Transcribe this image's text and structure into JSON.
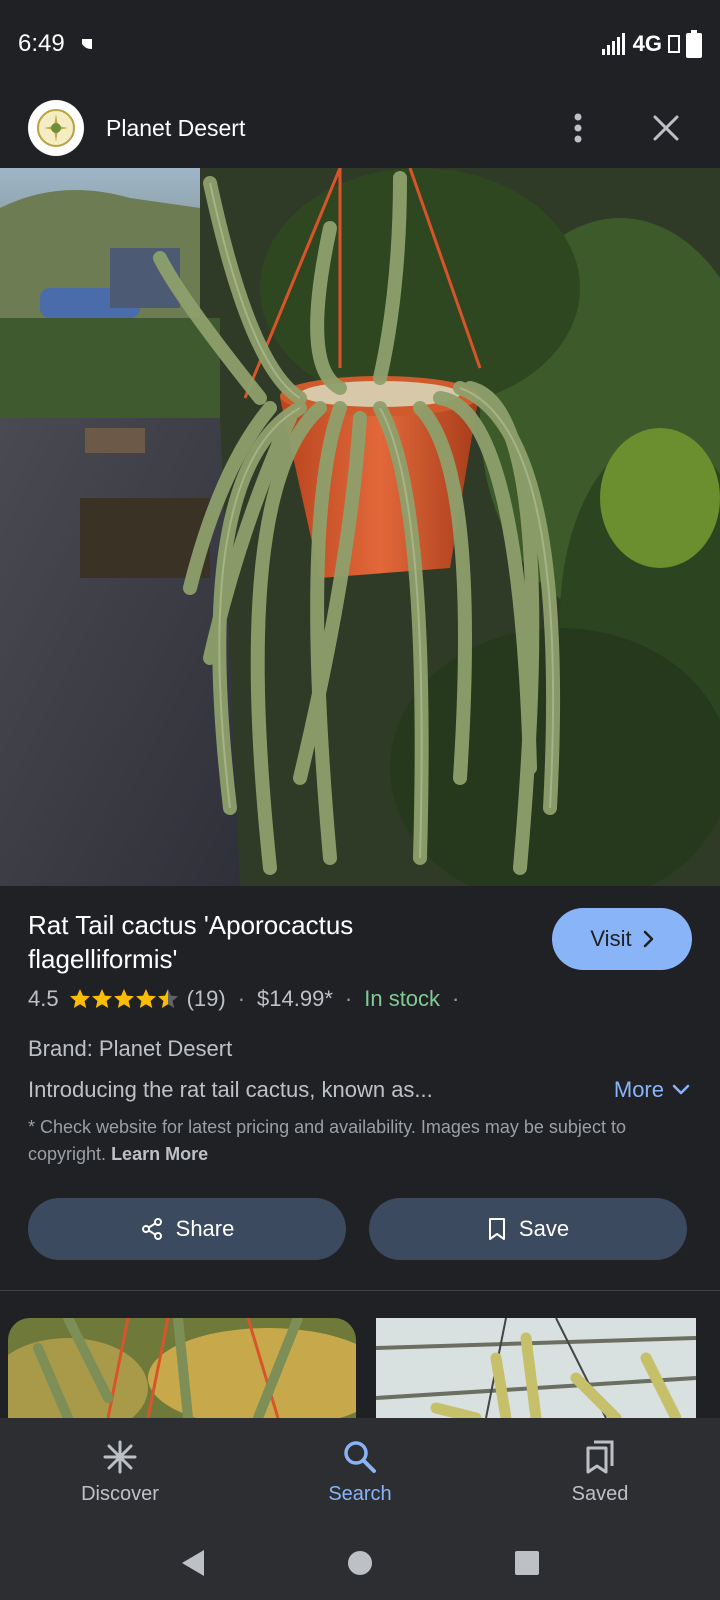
{
  "status_bar": {
    "time": "6:49",
    "network": "4G"
  },
  "header": {
    "site_name": "Planet Desert"
  },
  "product": {
    "title": "Rat Tail cactus 'Aporocactus flagelliformis'",
    "visit_label": "Visit",
    "rating": "4.5",
    "rating_stars": 4.5,
    "review_count": "(19)",
    "price": "$14.99*",
    "stock": "In stock",
    "brand": "Brand: Planet Desert",
    "description": "Introducing the rat tail cactus, known as...",
    "more_label": "More",
    "disclaimer": "* Check website for latest pricing and availability. Images may be subject to copyright.",
    "learn_more": "Learn More"
  },
  "actions": {
    "share_label": "Share",
    "save_label": "Save"
  },
  "bottom_nav": {
    "items": [
      {
        "label": "Discover",
        "icon": "asterisk-icon",
        "active": false
      },
      {
        "label": "Search",
        "icon": "search-icon",
        "active": true
      },
      {
        "label": "Saved",
        "icon": "saved-icon",
        "active": false
      }
    ]
  },
  "colors": {
    "accent": "#8ab4f8",
    "in_stock": "#81c995",
    "star": "#fbbc04",
    "button_bg": "#3c4a5f"
  }
}
